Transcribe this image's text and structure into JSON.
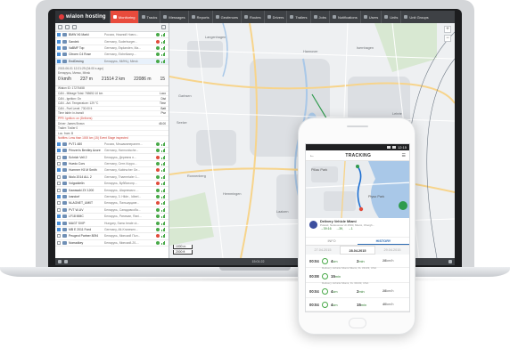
{
  "topbar": {
    "logo": "wialon hosting",
    "tabs": [
      {
        "label": "Monitoring",
        "active": true
      },
      {
        "label": "Tracks",
        "active": false
      },
      {
        "label": "Messages",
        "active": false
      },
      {
        "label": "Reports",
        "active": false
      },
      {
        "label": "Geofences",
        "active": false
      },
      {
        "label": "Routes",
        "active": false
      },
      {
        "label": "Drivers",
        "active": false
      },
      {
        "label": "Trailers",
        "active": false
      },
      {
        "label": "Jobs",
        "active": false
      },
      {
        "label": "Notifications",
        "active": false
      },
      {
        "label": "Users",
        "active": false
      },
      {
        "label": "Units",
        "active": false
      },
      {
        "label": "Unit Groups",
        "active": false
      }
    ]
  },
  "units": [
    {
      "name": "BMW X6 Markl",
      "addr": "Россия, Нижний Новго...",
      "checked": true,
      "status": "#48a948"
    },
    {
      "name": "Sandek",
      "addr": "Germany, Suderburger...",
      "checked": true,
      "status": "#e14b3b"
    },
    {
      "name": "VaBMF Top",
      "addr": "Germany, Esplanden, Ma...",
      "checked": true,
      "status": "#48a948"
    },
    {
      "name": "Citroen C4 Rose",
      "addr": "Germany, Eichelkamp...",
      "checked": true,
      "status": "#48a948"
    },
    {
      "name": "EndDesing",
      "addr": "Беларусь, МИНЦ, Minsk",
      "checked": true,
      "status": "#48a948"
    }
  ],
  "info": {
    "line1": "2015-06-01 12:21:29 (04:00 s ago)",
    "line2": "Беларусь, Минск, Minsk",
    "speed": "0 km/h",
    "height": "237 m",
    "mileage": "21514 2 km",
    "count": "22086 m",
    "sats": "15"
  },
  "props": [
    {
      "k": "Wialon ID: 17276458",
      "v": "",
      "red": false
    },
    {
      "k": "CAN - Mileage Total: 765652.10 km",
      "v": "Loco",
      "red": false
    },
    {
      "k": "CAN - Ignition: On",
      "v": "Dist",
      "red": false
    },
    {
      "k": "CAN - Ant. Temperature: 129 °C",
      "v": "Time",
      "red": false
    },
    {
      "k": "CAN - Fuel Level: 730.00 lt",
      "v": "Batt",
      "red": false
    },
    {
      "k": "Time table: in-transit",
      "v": "Pwr",
      "red": false
    },
    {
      "k": "PPR: Ignition: on (Delivers)",
      "v": "",
      "red": true
    },
    {
      "k": "Driver: James Brown",
      "v": "45.00",
      "red": false
    },
    {
      "k": "Trailer: Trailer 0",
      "v": "",
      "red": false
    },
    {
      "k": "Loc. from: B",
      "v": "",
      "red": false
    },
    {
      "k": "Notifies: Less than 1000 km (15) Event Stage inspected",
      "v": "",
      "red": true
    }
  ],
  "units2": [
    {
      "name": "PVT1 480",
      "addr": "Россия, Мешаминерален...",
      "checked": true,
      "status": "#48a948"
    },
    {
      "name": "Prinzen's Bentley Azure",
      "addr": "Germany, Harmonische...",
      "checked": true,
      "status": "#48a948"
    },
    {
      "name": "Schrich Vell 2",
      "addr": "Беларусь, Деревня н...",
      "checked": false,
      "status": "#e14b3b"
    },
    {
      "name": "Huedo Cors",
      "addr": "Germany, Сент-Коуро...",
      "checked": false,
      "status": "#48a948"
    },
    {
      "name": "Hummer H3 M Smith",
      "addr": "Germany, Kabirscher Ge...",
      "checked": true,
      "status": "#e14b3b"
    },
    {
      "name": "Niolo 2014 ALL 2",
      "addr": "Germany, Thaermtaler 1...",
      "checked": false,
      "status": "#48a948"
    },
    {
      "name": "Volgoddelin",
      "addr": "Беларусь, Вуйбипопр...",
      "checked": false,
      "status": "#e14b3b"
    },
    {
      "name": "Kawasaki ZX 1200",
      "addr": "Беларусь, Шарнемаго ...",
      "checked": false,
      "status": "#48a948"
    },
    {
      "name": "Ivandorf",
      "addr": "Germany, 3. Hilde., Idberl...",
      "checked": true,
      "status": "#48a948"
    },
    {
      "name": "NLAGNET_UM0T",
      "addr": "Беларусь, Пальшуцкие...",
      "checked": false,
      "status": "#e14b3b"
    },
    {
      "name": "PVT W-UV",
      "addr": "Беларусь, Сападовсоба...",
      "checked": false,
      "status": "#48a948"
    },
    {
      "name": "LF18 MMC",
      "addr": "Беларусь, Ратиман, Rani...",
      "checked": true,
      "status": "#48a948"
    },
    {
      "name": "MAGT SVIP",
      "addr": "Hungary, Samo beale ut...",
      "checked": true,
      "status": "#48a948"
    },
    {
      "name": "MB E 2011 Fond",
      "addr": "Germany, Alt-Kranesen...",
      "checked": true,
      "status": "#48a948"
    },
    {
      "name": "Peugeot Partner 8094",
      "addr": "Беларусь, Минский Пол...",
      "checked": false,
      "status": "#e14b3b"
    },
    {
      "name": "Nomadkey",
      "addr": "Беларусь, Минский-20-...",
      "checked": false,
      "status": "#48a948"
    }
  ],
  "map": {
    "places": [
      "Hannover",
      "Isernhagen",
      "Langenhagen",
      "Lehrte",
      "Sehnde",
      "Laatzen",
      "Hemmingen",
      "Ronnenberg",
      "Garbsen",
      "Seelze"
    ],
    "scale_top": "1000 m",
    "scale_bottom": "2000 ft",
    "zoom_in": "+",
    "zoom_out": "−"
  },
  "status_bar": {
    "text": "15:01:22"
  },
  "phone": {
    "time": "12:15",
    "title": "TRACKING",
    "map_labels": [
      "Pillau Park",
      "Plyso Park"
    ],
    "card": {
      "title": "Delivery Vehicle Miami",
      "sub": "Poland, Nettoxeres/ dr 2500, Miami, Ohergh...",
      "n1": "→39:16",
      "n2": "→39,",
      "n3": "→1"
    },
    "tabs": [
      {
        "label": "INFO",
        "active": false
      },
      {
        "label": "HISTORY",
        "active": true
      }
    ],
    "dates": [
      {
        "label": "27.04.2015",
        "active": false
      },
      {
        "label": "28.04.2015",
        "active": true
      },
      {
        "label": "29.04.2015",
        "active": false
      }
    ],
    "trips": [
      {
        "time": "00:04",
        "v1": "4",
        "u1": "km",
        "v2": "2",
        "u2": "min",
        "v3": "28",
        "u3": "km/h",
        "sub": "Delivery Vehicle Miami Miami, FL 33133, USA"
      },
      {
        "time": "00:08",
        "v1": "15",
        "u1": "min",
        "v2": "",
        "u2": "",
        "v3": "",
        "u3": "",
        "sub": "Delivery Vehicle Miami, FL 33133, USA"
      },
      {
        "time": "00:04",
        "v1": "4",
        "u1": "km",
        "v2": "2",
        "u2": "min",
        "v3": "28",
        "u3": "km/h",
        "sub": ""
      },
      {
        "time": "00:04",
        "v1": "4",
        "u1": "km",
        "v2": "15",
        "u2": "min",
        "v3": "40",
        "u3": "km/h",
        "sub": ""
      }
    ]
  },
  "colors": {
    "accent": "#e84b3c",
    "topbar": "#3e4145",
    "ok": "#48a948",
    "alarm": "#e14b3b",
    "route": "#2f9b4d",
    "water": "#a9c8e8"
  }
}
